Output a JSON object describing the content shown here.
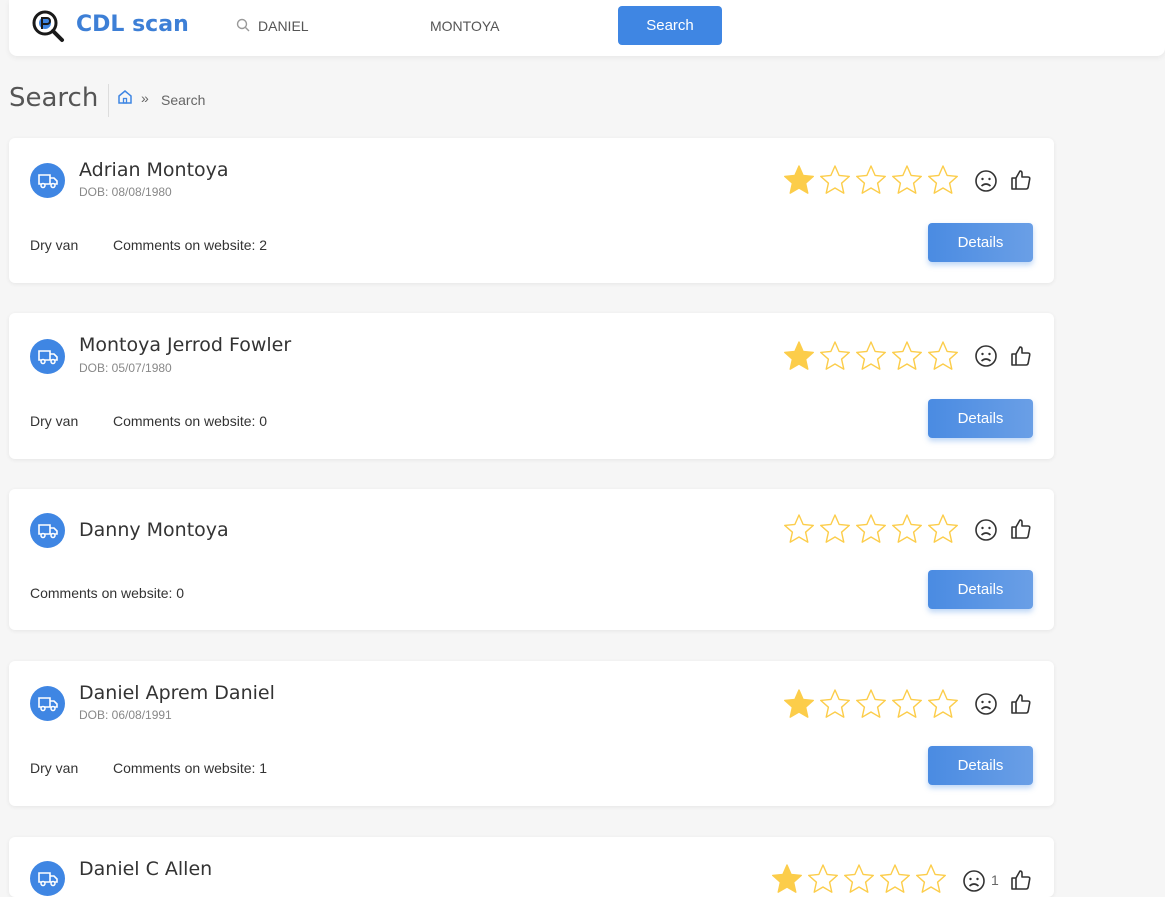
{
  "app": {
    "name": "CDL scan"
  },
  "search": {
    "first_name": "DANIEL",
    "last_name": "MONTOYA",
    "button": "Search"
  },
  "page": {
    "title": "Search",
    "breadcrumb_sep": "»",
    "breadcrumb_label": "Search"
  },
  "colors": {
    "accent": "#3f86e3",
    "star": "#fccd4a"
  },
  "drivers": [
    {
      "name": "Adrian Montoya",
      "dob": "DOB: 08/08/1980",
      "equipment": "Dry van",
      "comments": "Comments on website: 2",
      "rating": 1,
      "details": "Details"
    },
    {
      "name": "Montoya Jerrod Fowler",
      "dob": "DOB: 05/07/1980",
      "equipment": "Dry van",
      "comments": "Comments on website: 0",
      "rating": 1,
      "details": "Details"
    },
    {
      "name": "Danny Montoya",
      "dob": "",
      "equipment": "",
      "comments": "Comments on website: 0",
      "rating": 0,
      "details": "Details"
    },
    {
      "name": "Daniel Aprem Daniel",
      "dob": "DOB: 06/08/1991",
      "equipment": "Dry van",
      "comments": "Comments on website: 1",
      "rating": 1,
      "details": "Details"
    },
    {
      "name": "Daniel C Allen",
      "dob": "",
      "equipment": "",
      "comments": "",
      "rating": 1,
      "sad_count": "1",
      "details": ""
    }
  ]
}
